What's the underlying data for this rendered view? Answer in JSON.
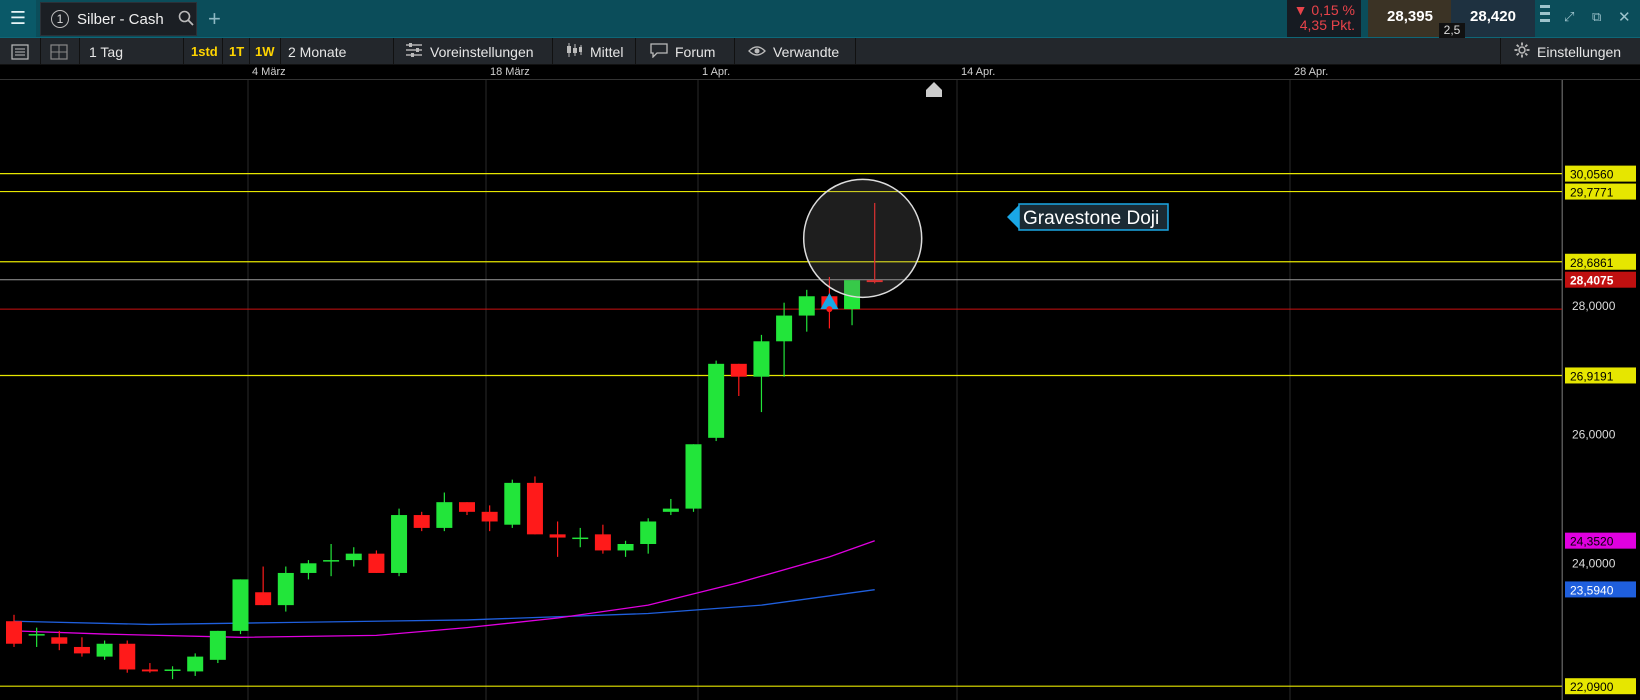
{
  "titlebar": {
    "tab_number": "1",
    "tab_title": "Silber - Cash",
    "change_percent": "0,15 %",
    "change_points": "4,35 Pkt.",
    "bid": "28,395",
    "ask": "28,420",
    "spread": "2,5"
  },
  "toolbar": {
    "interval": "1 Tag",
    "quick_1": "1std",
    "quick_2": "1T",
    "quick_3": "1W",
    "range": "2 Monate",
    "presets": "Voreinstellungen",
    "indicator": "Mittel",
    "forum": "Forum",
    "related": "Verwandte",
    "settings": "Einstellungen"
  },
  "time_axis": [
    "4 März",
    "18 März",
    "1 Apr.",
    "14 Apr.",
    "28 Apr."
  ],
  "annotation": {
    "label": "Gravestone Doji"
  },
  "colors": {
    "up": "#22e53a",
    "down": "#ff1a1a",
    "level_line": "#e6e600",
    "ma_fast": "#e000e0",
    "ma_slow": "#1f5fdd",
    "accent": "#0b4d5a"
  },
  "chart_data": {
    "type": "candlestick",
    "ylim": [
      22.0,
      31.2
    ],
    "price_ticks": [
      "28,0000",
      "26,0000",
      "24,0000"
    ],
    "current_price": "28,4075",
    "levels": [
      "30,0560",
      "29,7771",
      "28,6861",
      "26,9191",
      "22,0900"
    ],
    "ma_labels": [
      "24,3520",
      "23,5940"
    ],
    "stop_line": 27.95,
    "candles": [
      {
        "o": 23.1,
        "h": 23.2,
        "l": 22.7,
        "c": 22.75
      },
      {
        "o": 22.9,
        "h": 23.0,
        "l": 22.7,
        "c": 22.9
      },
      {
        "o": 22.85,
        "h": 22.95,
        "l": 22.65,
        "c": 22.75
      },
      {
        "o": 22.7,
        "h": 22.85,
        "l": 22.55,
        "c": 22.6
      },
      {
        "o": 22.55,
        "h": 22.8,
        "l": 22.5,
        "c": 22.75
      },
      {
        "o": 22.75,
        "h": 22.8,
        "l": 22.3,
        "c": 22.35
      },
      {
        "o": 22.35,
        "h": 22.45,
        "l": 22.3,
        "c": 22.32
      },
      {
        "o": 22.33,
        "h": 22.4,
        "l": 22.2,
        "c": 22.35
      },
      {
        "o": 22.32,
        "h": 22.6,
        "l": 22.25,
        "c": 22.55
      },
      {
        "o": 22.5,
        "h": 22.95,
        "l": 22.45,
        "c": 22.95
      },
      {
        "o": 22.95,
        "h": 23.75,
        "l": 22.9,
        "c": 23.75
      },
      {
        "o": 23.55,
        "h": 23.95,
        "l": 23.35,
        "c": 23.35
      },
      {
        "o": 23.35,
        "h": 23.95,
        "l": 23.25,
        "c": 23.85
      },
      {
        "o": 23.85,
        "h": 24.05,
        "l": 23.75,
        "c": 24.0
      },
      {
        "o": 24.05,
        "h": 24.3,
        "l": 23.8,
        "c": 24.05
      },
      {
        "o": 24.05,
        "h": 24.25,
        "l": 23.95,
        "c": 24.15
      },
      {
        "o": 24.15,
        "h": 24.2,
        "l": 23.85,
        "c": 23.85
      },
      {
        "o": 23.85,
        "h": 24.85,
        "l": 23.8,
        "c": 24.75
      },
      {
        "o": 24.75,
        "h": 24.8,
        "l": 24.5,
        "c": 24.55
      },
      {
        "o": 24.55,
        "h": 25.1,
        "l": 24.5,
        "c": 24.95
      },
      {
        "o": 24.95,
        "h": 24.95,
        "l": 24.75,
        "c": 24.8
      },
      {
        "o": 24.8,
        "h": 24.9,
        "l": 24.5,
        "c": 24.65
      },
      {
        "o": 24.6,
        "h": 25.3,
        "l": 24.55,
        "c": 25.25
      },
      {
        "o": 25.25,
        "h": 25.35,
        "l": 24.45,
        "c": 24.45
      },
      {
        "o": 24.45,
        "h": 24.65,
        "l": 24.1,
        "c": 24.4
      },
      {
        "o": 24.4,
        "h": 24.55,
        "l": 24.25,
        "c": 24.4
      },
      {
        "o": 24.45,
        "h": 24.6,
        "l": 24.15,
        "c": 24.2
      },
      {
        "o": 24.2,
        "h": 24.35,
        "l": 24.1,
        "c": 24.3
      },
      {
        "o": 24.3,
        "h": 24.7,
        "l": 24.15,
        "c": 24.65
      },
      {
        "o": 24.8,
        "h": 25.0,
        "l": 24.75,
        "c": 24.85
      },
      {
        "o": 24.85,
        "h": 25.85,
        "l": 24.8,
        "c": 25.85
      },
      {
        "o": 25.95,
        "h": 27.15,
        "l": 25.9,
        "c": 27.1
      },
      {
        "o": 27.1,
        "h": 27.1,
        "l": 26.6,
        "c": 26.9
      },
      {
        "o": 26.9,
        "h": 27.55,
        "l": 26.35,
        "c": 27.45
      },
      {
        "o": 27.45,
        "h": 28.05,
        "l": 26.9,
        "c": 27.85
      },
      {
        "o": 27.85,
        "h": 28.25,
        "l": 27.6,
        "c": 28.15
      },
      {
        "o": 28.15,
        "h": 28.45,
        "l": 27.65,
        "c": 27.95
      },
      {
        "o": 27.95,
        "h": 28.4,
        "l": 27.7,
        "c": 28.4
      },
      {
        "o": 28.4,
        "h": 29.6,
        "l": 28.35,
        "c": 28.37
      }
    ],
    "ma_fast": [
      {
        "i": 0,
        "v": 22.95
      },
      {
        "i": 4,
        "v": 22.9
      },
      {
        "i": 10,
        "v": 22.85
      },
      {
        "i": 16,
        "v": 22.88
      },
      {
        "i": 20,
        "v": 23.0
      },
      {
        "i": 24,
        "v": 23.15
      },
      {
        "i": 28,
        "v": 23.35
      },
      {
        "i": 32,
        "v": 23.7
      },
      {
        "i": 36,
        "v": 24.1
      },
      {
        "i": 38,
        "v": 24.35
      }
    ],
    "ma_slow": [
      {
        "i": 0,
        "v": 23.1
      },
      {
        "i": 6,
        "v": 23.05
      },
      {
        "i": 12,
        "v": 23.08
      },
      {
        "i": 20,
        "v": 23.12
      },
      {
        "i": 28,
        "v": 23.22
      },
      {
        "i": 33,
        "v": 23.35
      },
      {
        "i": 38,
        "v": 23.59
      }
    ]
  }
}
